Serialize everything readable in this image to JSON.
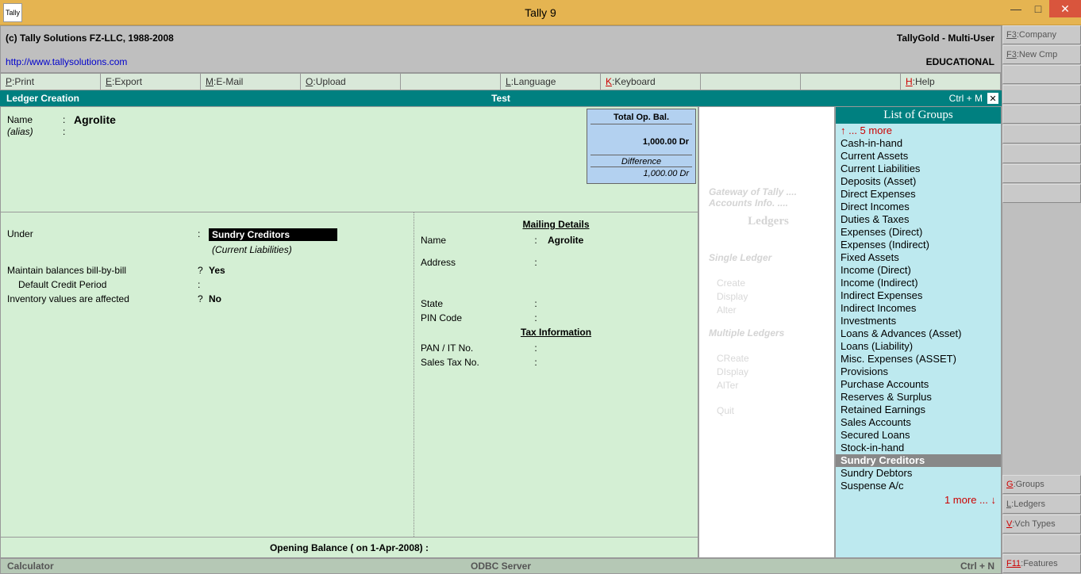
{
  "titlebar": {
    "title": "Tally 9",
    "icon": "Tally"
  },
  "copyright": {
    "text": "(c) Tally Solutions FZ-LLC, 1988-2008",
    "edition": "TallyGold - Multi-User",
    "url": "http://www.tallysolutions.com",
    "edu": "EDUCATIONAL"
  },
  "menu": {
    "print": "Print",
    "export": "Export",
    "email": "E-Mail",
    "upload": "Upload",
    "language": "Language",
    "keyboard": "Keyboard",
    "help": "Help"
  },
  "subheader": {
    "left": "Ledger Creation",
    "center": "Test",
    "right": "Ctrl + M"
  },
  "ledger": {
    "name_label": "Name",
    "name_value": "Agrolite",
    "alias_label": "(alias)",
    "under_label": "Under",
    "under_value": "Sundry Creditors",
    "under_sub": "(Current Liabilities)",
    "billbybill_label": "Maintain balances bill-by-bill",
    "billbybill_value": "Yes",
    "credit_label": "Default Credit Period",
    "inventory_label": "Inventory values are affected",
    "inventory_value": "No",
    "opbal": {
      "title": "Total Op. Bal.",
      "amount": "1,000.00 Dr",
      "diff_label": "Difference",
      "diff_amount": "1,000.00 Dr"
    },
    "mailing_heading": "Mailing Details",
    "mailing_name_label": "Name",
    "mailing_name_value": "Agrolite",
    "address_label": "Address",
    "state_label": "State",
    "pin_label": "PIN Code",
    "tax_heading": "Tax Information",
    "pan_label": "PAN / IT No.",
    "salestax_label": "Sales Tax No.",
    "ob_footer": "Opening Balance  ( on 1-Apr-2008) :"
  },
  "gateway": {
    "path1": "Gateway of Tally ....",
    "path2": "Accounts Info. ....",
    "ledgers": "Ledgers",
    "single": "Single Ledger",
    "multiple": "Multiple Ledgers",
    "create": "Create",
    "display": "Display",
    "alter": "Alter",
    "create2": "CReate",
    "display2": "DIsplay",
    "alter2": "AlTer",
    "quit": "Quit"
  },
  "groups": {
    "header": "List of Groups",
    "more_top": "↑ ... 5 more",
    "items": [
      "Cash-in-hand",
      "Current Assets",
      "Current Liabilities",
      "Deposits (Asset)",
      "Direct Expenses",
      "Direct Incomes",
      "Duties & Taxes",
      "Expenses (Direct)",
      "Expenses (Indirect)",
      "Fixed Assets",
      "Income (Direct)",
      "Income (Indirect)",
      "Indirect Expenses",
      "Indirect Incomes",
      "Investments",
      "Loans & Advances (Asset)",
      "Loans (Liability)",
      "Misc. Expenses (ASSET)",
      "Provisions",
      "Purchase Accounts",
      "Reserves & Surplus",
      "Retained Earnings",
      "Sales Accounts",
      "Secured Loans",
      "Stock-in-hand",
      "Sundry Creditors",
      "Sundry Debtors",
      "Suspense A/c"
    ],
    "selected_index": 25,
    "more_bot": "1 more ... ↓"
  },
  "status": {
    "calculator": "Calculator",
    "odbc": "ODBC Server",
    "right": "Ctrl + N"
  },
  "sidebar": {
    "company": "Company",
    "newcmp": "New Cmp",
    "groups": "Groups",
    "ledgers": "Ledgers",
    "vchtypes": "Vch Types",
    "features": "Features"
  }
}
